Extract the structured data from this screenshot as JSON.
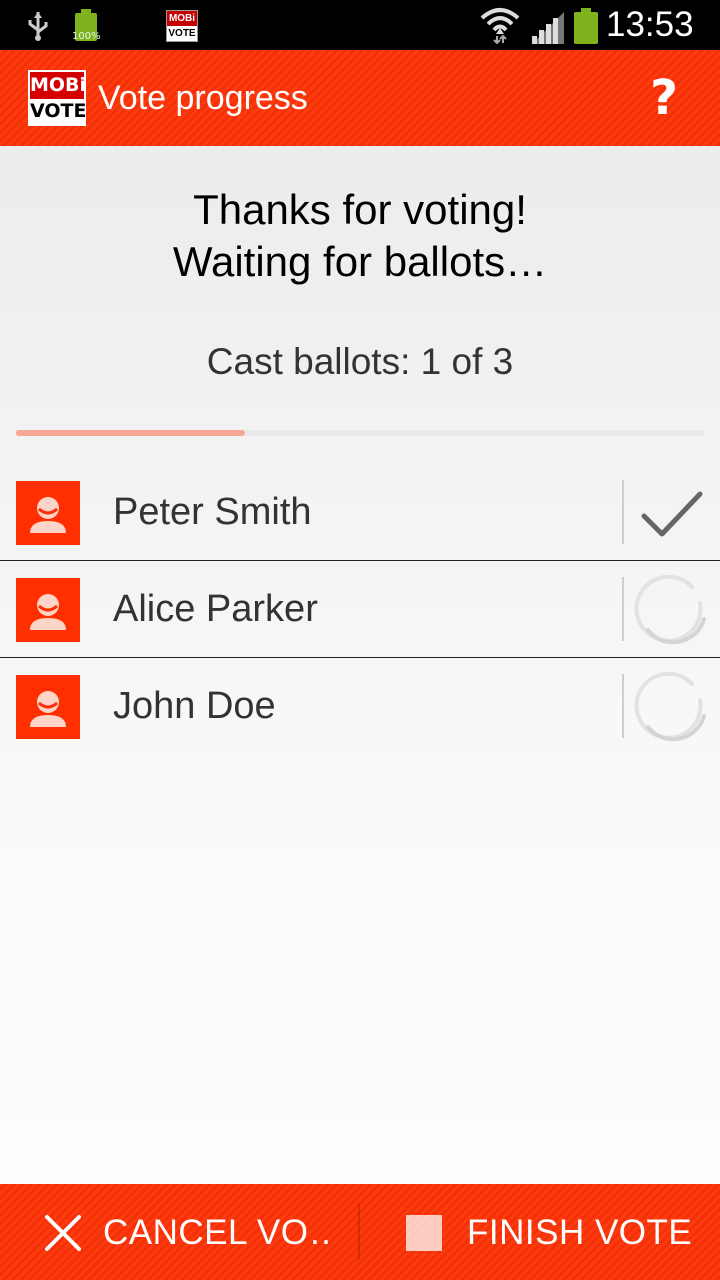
{
  "status_bar": {
    "time": "13:53",
    "battery_small_pct": "100%",
    "icons": [
      "usb-icon",
      "battery-icon",
      "mobivote-app-icon",
      "wifi-icon",
      "signal-icon",
      "battery-icon"
    ],
    "app_icon_top": "MOBi",
    "app_icon_bottom": "VOTE"
  },
  "action_bar": {
    "logo_top": "MOBi",
    "logo_bottom": "VOTE",
    "title": "Vote progress",
    "help_label": "?"
  },
  "content": {
    "thanks_line1": "Thanks for voting!",
    "thanks_line2": "Waiting for ballots…",
    "cast_text": "Cast ballots: 1 of 3",
    "cast_done": 1,
    "cast_total": 3
  },
  "voters": [
    {
      "name": "Peter Smith",
      "status": "done"
    },
    {
      "name": "Alice Parker",
      "status": "pending"
    },
    {
      "name": "John Doe",
      "status": "pending"
    }
  ],
  "bottom_bar": {
    "cancel_label": "CANCEL VO…",
    "finish_label": "FINISH VOTE"
  },
  "colors": {
    "accent": "#ff3a10",
    "avatar": "#ff2f00",
    "progress": "#f6a796",
    "battery": "#7fb21c"
  }
}
